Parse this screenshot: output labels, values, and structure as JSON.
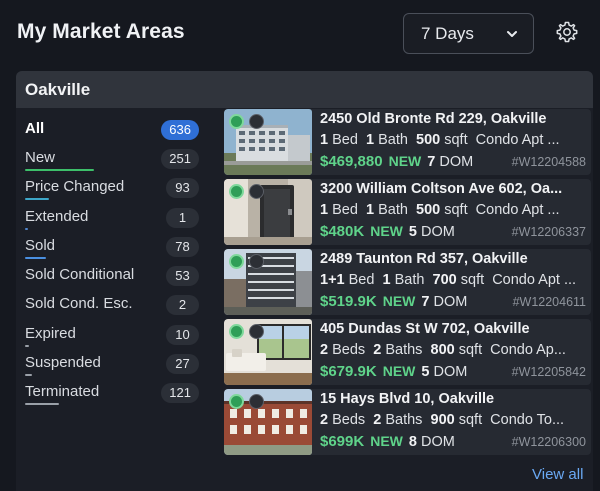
{
  "header": {
    "title": "My Market Areas",
    "period": "7 Days"
  },
  "area": {
    "name": "Oakville"
  },
  "statuses": [
    {
      "label": "All",
      "count": "636",
      "active": true,
      "line_color": ""
    },
    {
      "label": "New",
      "count": "251",
      "active": false,
      "line_color": "#3dbf6a"
    },
    {
      "label": "Price Changed",
      "count": "93",
      "active": false,
      "line_color": "#3da7c9"
    },
    {
      "label": "Extended",
      "count": "1",
      "active": false,
      "line_color": "#4f84c9"
    },
    {
      "label": "Sold",
      "count": "78",
      "active": false,
      "line_color": "#4a8fe0"
    },
    {
      "label": "Sold Conditional",
      "count": "53",
      "active": false,
      "line_color": ""
    },
    {
      "label": "Sold Cond. Esc.",
      "count": "2",
      "active": false,
      "line_color": ""
    },
    {
      "label": "Expired",
      "count": "10",
      "active": false,
      "line_color": "#9aa0a8"
    },
    {
      "label": "Suspended",
      "count": "27",
      "active": false,
      "line_color": "#9aa0a8"
    },
    {
      "label": "Terminated",
      "count": "121",
      "active": false,
      "line_color": "#9aa0a8"
    }
  ],
  "listings": [
    {
      "address": "2450 Old Bronte Rd 229, Oakville",
      "beds": "1",
      "beds_label": "Bed",
      "baths": "1",
      "baths_label": "Bath",
      "sqft": "500",
      "sqft_label": "sqft",
      "type": "Condo Apt ...",
      "price": "$469,880",
      "status": "NEW",
      "dom": "7",
      "dom_label": "DOM",
      "mls": "#W12204588"
    },
    {
      "address": "3200 William Coltson Ave 602, Oa...",
      "beds": "1",
      "beds_label": "Bed",
      "baths": "1",
      "baths_label": "Bath",
      "sqft": "500",
      "sqft_label": "sqft",
      "type": "Condo Apt ...",
      "price": "$480K",
      "status": "NEW",
      "dom": "5",
      "dom_label": "DOM",
      "mls": "#W12206337"
    },
    {
      "address": "2489 Taunton Rd 357, Oakville",
      "beds": "1+1",
      "beds_label": "Bed",
      "baths": "1",
      "baths_label": "Bath",
      "sqft": "700",
      "sqft_label": "sqft",
      "type": "Condo Apt ...",
      "price": "$519.9K",
      "status": "NEW",
      "dom": "7",
      "dom_label": "DOM",
      "mls": "#W12204611"
    },
    {
      "address": "405 Dundas St W 702, Oakville",
      "beds": "2",
      "beds_label": "Beds",
      "baths": "2",
      "baths_label": "Baths",
      "sqft": "800",
      "sqft_label": "sqft",
      "type": "Condo Ap...",
      "price": "$679.9K",
      "status": "NEW",
      "dom": "5",
      "dom_label": "DOM",
      "mls": "#W12205842"
    },
    {
      "address": "15 Hays Blvd 10, Oakville",
      "beds": "2",
      "beds_label": "Beds",
      "baths": "2",
      "baths_label": "Baths",
      "sqft": "900",
      "sqft_label": "sqft",
      "type": "Condo To...",
      "price": "$699K",
      "status": "NEW",
      "dom": "8",
      "dom_label": "DOM",
      "mls": "#W12206300"
    }
  ],
  "footer": {
    "view_all": "View all"
  },
  "colors": {
    "accent_blue": "#2f6fd6",
    "price_green": "#5fd38a",
    "link_blue": "#6aa9f4"
  },
  "icons": {
    "period_chevron": "chevron-down-icon",
    "settings": "gear-icon",
    "listing_status": "status-dot-icon",
    "listing_favorite": "favorite-dot-icon"
  }
}
